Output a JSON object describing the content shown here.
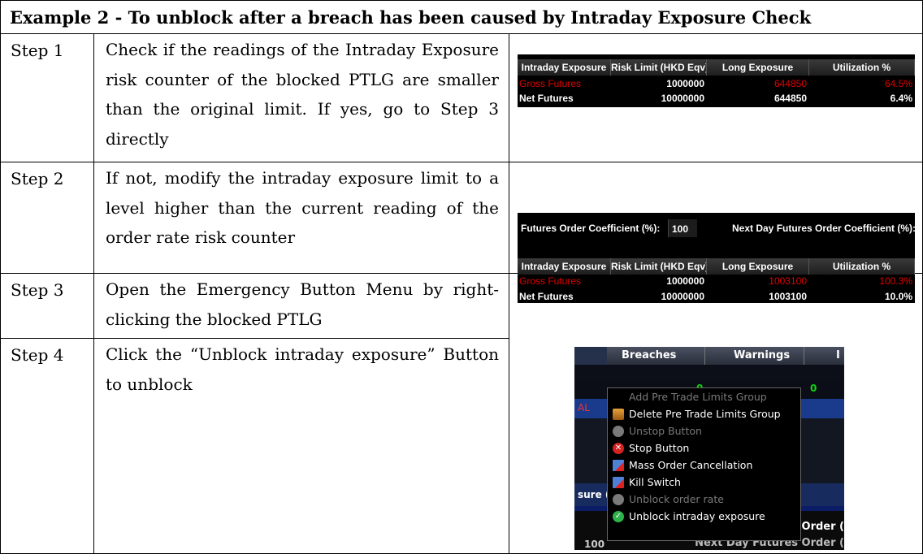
{
  "title": "Example 2 - To unblock after a breach has been caused by Intraday Exposure Check",
  "steps": [
    {
      "label": "Step 1",
      "text": "Check if the readings of the Intraday Exposure risk counter of the blocked PTLG are smaller than the original limit. If yes, go to Step 3 directly"
    },
    {
      "label": "Step 2",
      "text": "If not, modify the intraday exposure limit to a level higher than the current reading of the order rate risk counter"
    },
    {
      "label": "Step 3",
      "text": "Open the Emergency Button Menu by right-clicking the blocked PTLG"
    },
    {
      "label": "Step 4",
      "text": "Click the “Unblock intraday exposure” Button to unblock"
    }
  ],
  "shot1": {
    "headers": [
      "Intraday Exposure",
      "Risk Limit (HKD Eqv)",
      "Long Exposure",
      "Utilization %"
    ],
    "row": {
      "name": "Gross Futures",
      "limit": "1000000",
      "exposure": "644850",
      "util": "64.5%"
    },
    "partial_row": {
      "name": "Net Futures",
      "limit": "10000000",
      "exposure": "644850",
      "util": "6.4%"
    }
  },
  "shot2": {
    "coef_label": "Futures Order Coefficient (%):",
    "coef_value": "100",
    "next_label": "Next Day Futures Order Coefficient (%):",
    "headers": [
      "Intraday Exposure",
      "Risk Limit (HKD Eqv)",
      "Long Exposure",
      "Utilization %"
    ],
    "row": {
      "name": "Gross Futures",
      "limit": "1000000",
      "exposure": "1003100",
      "util": "100.3%"
    },
    "partial_row": {
      "name": "Net Futures",
      "limit": "10000000",
      "exposure": "1003100",
      "util": "10.0%"
    }
  },
  "shot3": {
    "col_breaches": "Breaches",
    "col_warnings": "Warnings",
    "zero1": "0",
    "zero2": "0",
    "side_label": "AL",
    "tab_fragment": "sure (",
    "order_fragment": "; Order (",
    "next_fragment": "Next Day Futures Order (",
    "value_fragment": "100",
    "menu": [
      {
        "label": "Add Pre Trade Limits Group",
        "enabled": false,
        "icon": "none"
      },
      {
        "label": "Delete Pre Trade Limits Group",
        "enabled": true,
        "icon": "group-delete-icon"
      },
      {
        "label": "Unstop Button",
        "enabled": false,
        "icon": "unstop-icon"
      },
      {
        "label": "Stop Button",
        "enabled": true,
        "icon": "stop-icon"
      },
      {
        "label": "Mass Order Cancellation",
        "enabled": true,
        "icon": "mass-cancel-icon"
      },
      {
        "label": "Kill Switch",
        "enabled": true,
        "icon": "kill-switch-icon"
      },
      {
        "label": "Unblock order rate",
        "enabled": false,
        "icon": "unblock-order-rate-icon"
      },
      {
        "label": "Unblock intraday exposure",
        "enabled": true,
        "icon": "unblock-exposure-icon"
      }
    ]
  }
}
